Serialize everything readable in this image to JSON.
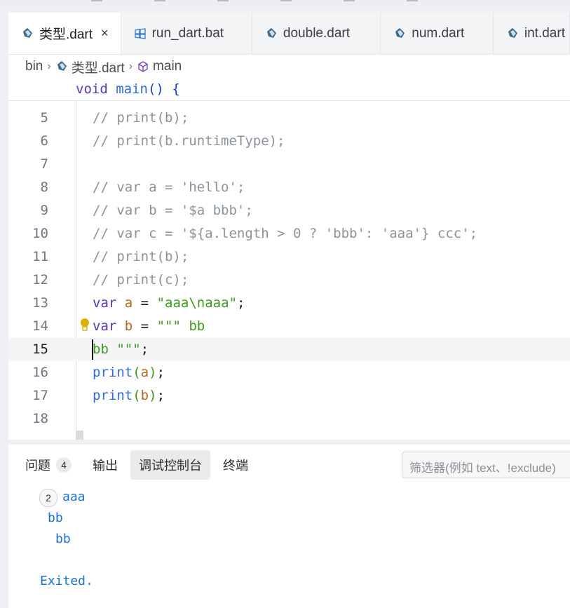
{
  "tabs": [
    {
      "label": "类型.dart",
      "icon": "dart-icon",
      "active": true,
      "close": "×"
    },
    {
      "label": "run_dart.bat",
      "icon": "windows-icon",
      "active": false
    },
    {
      "label": "double.dart",
      "icon": "dart-icon",
      "active": false
    },
    {
      "label": "num.dart",
      "icon": "dart-icon",
      "active": false
    },
    {
      "label": "int.dart",
      "icon": "dart-icon",
      "active": false
    }
  ],
  "breadcrumb": {
    "root": "bin",
    "sep": "›",
    "file": "类型.dart",
    "symbol": "main"
  },
  "sticky": {
    "t1": "void",
    "t2": " ",
    "t3": "main",
    "t4": "()",
    "t5": " ",
    "t6": "{"
  },
  "lines": [
    {
      "n": "5",
      "tokens": [
        "// print(b);"
      ]
    },
    {
      "n": "6",
      "tokens": [
        "// print(b.runtimeType);"
      ]
    },
    {
      "n": "7",
      "tokens": []
    },
    {
      "n": "8",
      "tokens": [
        "// var a = 'hello';"
      ]
    },
    {
      "n": "9",
      "tokens": [
        "// var b = '$a bbb';"
      ]
    },
    {
      "n": "10",
      "tokens": [
        "// var c = '${a.length > 0 ? 'bbb': 'aaa'} ccc';"
      ]
    },
    {
      "n": "11",
      "tokens": [
        "// print(b);"
      ]
    },
    {
      "n": "12",
      "tokens": [
        "// print(c);"
      ]
    },
    {
      "n": "13",
      "tokens": [
        "var",
        " ",
        "a",
        " = ",
        "\"aaa\\naaa\"",
        ";"
      ]
    },
    {
      "n": "14",
      "tokens": [
        "var",
        " ",
        "b",
        " = ",
        "\"\"\" bb"
      ]
    },
    {
      "n": "15",
      "tokens": [
        "bb \"\"\"",
        ";"
      ]
    },
    {
      "n": "16",
      "tokens": [
        "print",
        "(",
        "a",
        ")",
        ";"
      ]
    },
    {
      "n": "17",
      "tokens": [
        "print",
        "(",
        "b",
        ")",
        ";"
      ]
    },
    {
      "n": "18",
      "tokens": []
    }
  ],
  "panel": {
    "tabs": [
      {
        "label": "问题",
        "badge": "4"
      },
      {
        "label": "输出"
      },
      {
        "label": "调试控制台",
        "active": true
      },
      {
        "label": "终端"
      }
    ],
    "filter_placeholder": "筛选器(例如 text、!exclude)",
    "output": {
      "count": "2",
      "line1": "aaa",
      "line2": "bb",
      "line3": "bb",
      "exited": "Exited."
    }
  },
  "colors": {
    "keyword": "#5a33b7",
    "function": "#2f6bd6",
    "variable": "#b2691e",
    "string": "#3d9a1f",
    "comment": "#8c939c",
    "output": "#1a73d8"
  }
}
